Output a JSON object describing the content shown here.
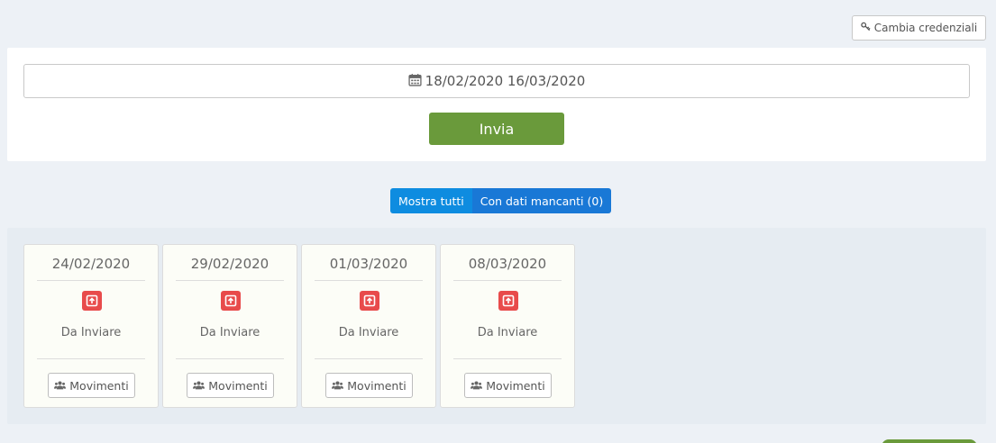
{
  "header": {
    "credentials_label": "Cambia credenziali",
    "credentials_icon": "key-icon"
  },
  "filter": {
    "date_range": "18/02/2020 16/03/2020",
    "date_icon": "calendar-icon",
    "submit_label": "Invia"
  },
  "toggle": {
    "show_all_label": "Mostra tutti",
    "missing_data_label": "Con dati mancanti (0)",
    "active": "show_all"
  },
  "cards": [
    {
      "date": "24/02/2020",
      "status": "Da Inviare",
      "status_icon": "upload-icon",
      "button_label": "Movimenti",
      "button_icon": "users-icon"
    },
    {
      "date": "29/02/2020",
      "status": "Da Inviare",
      "status_icon": "upload-icon",
      "button_label": "Movimenti",
      "button_icon": "users-icon"
    },
    {
      "date": "01/03/2020",
      "status": "Da Inviare",
      "status_icon": "upload-icon",
      "button_label": "Movimenti",
      "button_icon": "users-icon"
    },
    {
      "date": "08/03/2020",
      "status": "Da Inviare",
      "status_icon": "upload-icon",
      "button_label": "Movimenti",
      "button_icon": "users-icon"
    }
  ],
  "colors": {
    "primary_green": "#6a9a3b",
    "accent_blue": "#1a82d6",
    "status_red": "#e84b4b",
    "page_bg": "#edf1f6"
  }
}
